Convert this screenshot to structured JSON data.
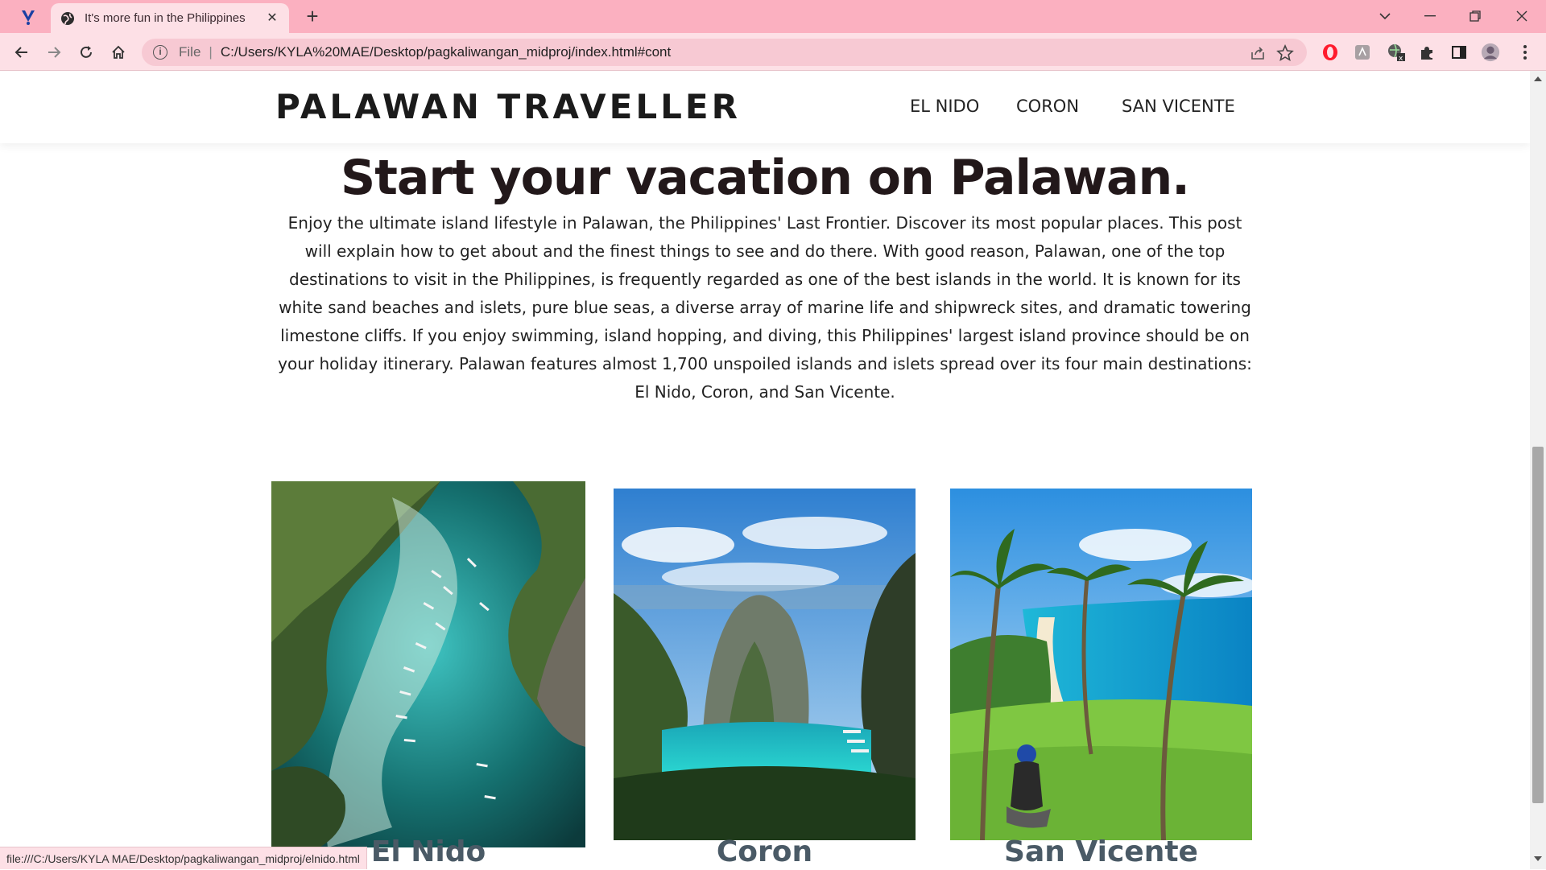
{
  "browser": {
    "tab_title": "It's more fun in the Philippines",
    "close_glyph": "✕",
    "newtab_glyph": "+",
    "url_scheme": "File",
    "url_separator": "|",
    "url": "C:/Users/KYLA%20MAE/Desktop/pagkaliwangan_midproj/index.html#cont",
    "status_url": "file:///C:/Users/KYLA MAE/Desktop/pagkaliwangan_midproj/elnido.html",
    "window_controls": {
      "chevron": "⌄",
      "minimize": "—",
      "restore": "❐",
      "close": "✕"
    }
  },
  "site": {
    "logo": "PALAWAN TRAVELLER",
    "nav": [
      "EL NIDO",
      "CORON",
      "SAN VICENTE"
    ]
  },
  "hero": {
    "title": "Start your vacation on Palawan.",
    "body": "Enjoy the ultimate island lifestyle in Palawan, the Philippines' Last Frontier. Discover its most popular places. This post will explain how to get about and the finest things to see and do there. With good reason, Palawan, one of the top destinations to visit in the Philippines, is frequently regarded as one of the best islands in the world. It is known for its white sand beaches and islets, pure blue seas, a diverse array of marine life and shipwreck sites, and dramatic towering limestone cliffs. If you enjoy swimming, island hopping, and diving, this Philippines' largest island province should be on your holiday itinerary. Palawan features almost 1,700 unspoiled islands and islets spread over its four main destinations: El Nido, Coron, and San Vicente."
  },
  "cards": [
    {
      "label": "El Nido"
    },
    {
      "label": "Coron"
    },
    {
      "label": "San Vicente"
    }
  ],
  "colors": {
    "tabstrip": "#fbb0c0",
    "toolbar": "#fde0e6",
    "heading": "#22181a",
    "card_label": "#4a5a66"
  },
  "icons": [
    "app-logo-icon",
    "globe-icon",
    "back-icon",
    "forward-icon",
    "reload-icon",
    "home-icon",
    "info-icon",
    "share-icon",
    "star-icon",
    "opera-icon",
    "pdf-icon",
    "extension-translate-icon",
    "puzzle-icon",
    "sidepanel-icon",
    "profile-avatar-icon",
    "kebab-menu-icon"
  ]
}
